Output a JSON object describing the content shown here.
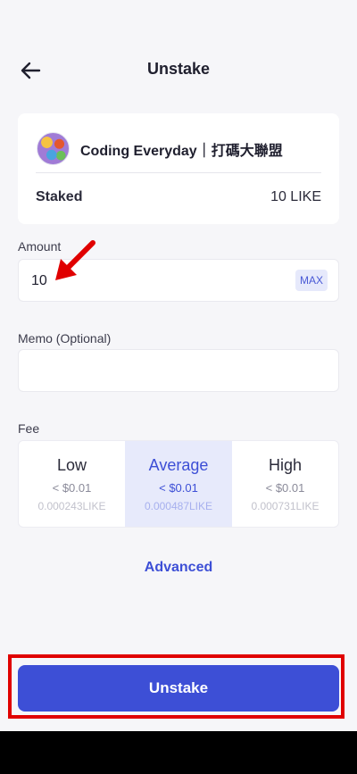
{
  "header": {
    "title": "Unstake"
  },
  "validator": {
    "name": "Coding Everyday｜打碼大聯盟",
    "staked_label": "Staked",
    "staked_value": "10 LIKE"
  },
  "amount": {
    "label": "Amount",
    "value": "10",
    "max_label": "MAX"
  },
  "memo": {
    "label": "Memo (Optional)",
    "value": ""
  },
  "fee": {
    "label": "Fee",
    "options": [
      {
        "name": "Low",
        "usd": "< $0.01",
        "like": "0.000243LIKE"
      },
      {
        "name": "Average",
        "usd": "< $0.01",
        "like": "0.000487LIKE"
      },
      {
        "name": "High",
        "usd": "< $0.01",
        "like": "0.000731LIKE"
      }
    ],
    "selected": "Average"
  },
  "advanced_label": "Advanced",
  "submit_label": "Unstake",
  "colors": {
    "accent": "#3d4fd6",
    "selected_bg": "#e7eafb",
    "annotation": "#e00000"
  }
}
